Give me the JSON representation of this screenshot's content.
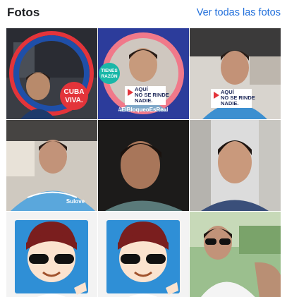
{
  "header": {
    "title": "Fotos",
    "see_all_label": "Ver todas las fotos"
  },
  "photos": [
    {
      "badge_line1": "CUBA",
      "badge_line2": "VIVA."
    },
    {
      "badge_line1": "TIENES",
      "badge_line2": "RAZÓN",
      "banner_line1": "AQUÍ",
      "banner_line2": "NO SE RINDE",
      "banner_line3": "NADIE.",
      "hashtag": "#ElBloqueoEsReal"
    },
    {
      "banner_line1": "AQUÍ",
      "banner_line2": "NO SE RINDE",
      "banner_line3": "NADIE."
    },
    {
      "shirt_text": "Sulove"
    },
    {},
    {},
    {},
    {},
    {}
  ],
  "colors": {
    "link": "#216fdb",
    "frame_red": "#e3343a",
    "frame_blue": "#1f4fa8",
    "frame_pink": "#f0798a",
    "frame_navy": "#2c3c9b",
    "sticker_blue": "#2f8fd6"
  },
  "icons": {
    "play_badge": "play-triangle-icon"
  }
}
